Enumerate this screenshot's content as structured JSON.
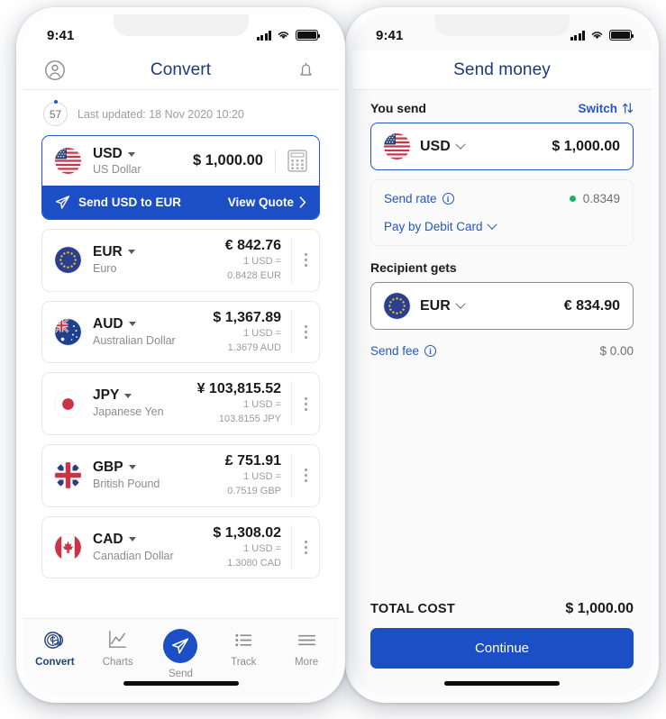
{
  "left_phone": {
    "status_bar": {
      "time": "9:41",
      "signal_icon": "cellular-bars-icon",
      "wifi_icon": "wifi-icon",
      "battery_icon": "battery-full-icon"
    },
    "header": {
      "title": "Convert",
      "profile_icon": "account-circle-icon",
      "bell_icon": "notification-bell-icon"
    },
    "updated": {
      "countdown": "57",
      "text": "Last updated: 18 Nov 2020 10:20"
    },
    "featured": {
      "code": "USD",
      "name": "US Dollar",
      "amount": "$ 1,000.00",
      "calculator_icon": "calculator-icon",
      "banner_text": "Send USD to EUR",
      "banner_icon": "paper-plane-icon",
      "banner_action": "View Quote",
      "banner_chevron": "chevron-right-icon"
    },
    "currencies": [
      {
        "code": "EUR",
        "name": "Euro",
        "amount": "€ 842.76",
        "rate_line1": "1 USD =",
        "rate_line2": "0.8428 EUR",
        "flag": "eu"
      },
      {
        "code": "AUD",
        "name": "Australian Dollar",
        "amount": "$ 1,367.89",
        "rate_line1": "1 USD =",
        "rate_line2": "1.3679 AUD",
        "flag": "au"
      },
      {
        "code": "JPY",
        "name": "Japanese Yen",
        "amount": "¥ 103,815.52",
        "rate_line1": "1 USD =",
        "rate_line2": "103.8155 JPY",
        "flag": "jp"
      },
      {
        "code": "GBP",
        "name": "British Pound",
        "amount": "£ 751.91",
        "rate_line1": "1 USD =",
        "rate_line2": "0.7519 GBP",
        "flag": "gb"
      },
      {
        "code": "CAD",
        "name": "Canadian Dollar",
        "amount": "$ 1,308.02",
        "rate_line1": "1 USD =",
        "rate_line2": "1.3080 CAD",
        "flag": "ca"
      }
    ],
    "tabs": [
      {
        "label": "Convert",
        "icon": "coins-dollar-icon",
        "active": true
      },
      {
        "label": "Charts",
        "icon": "line-chart-icon",
        "active": false
      },
      {
        "label": "Send",
        "icon": "paper-plane-icon",
        "active": false
      },
      {
        "label": "Track",
        "icon": "list-icon",
        "active": false
      },
      {
        "label": "More",
        "icon": "hamburger-menu-icon",
        "active": false
      }
    ]
  },
  "right_phone": {
    "status_bar": {
      "time": "9:41",
      "signal_icon": "cellular-bars-icon",
      "wifi_icon": "wifi-icon",
      "battery_icon": "battery-full-icon"
    },
    "header": {
      "title": "Send money"
    },
    "you_send": {
      "label": "You send",
      "switch_label": "Switch",
      "switch_icon": "swap-vertical-arrows-icon",
      "currency": "USD",
      "amount": "$ 1,000.00",
      "flag": "us"
    },
    "rate_panel": {
      "send_rate_label": "Send rate",
      "send_rate_info_icon": "info-circle-icon",
      "send_rate_value": "0.8349",
      "status_dot_color": "#18b46b",
      "pay_method_label": "Pay by Debit Card",
      "pay_method_chevron": "chevron-down-icon"
    },
    "recipient": {
      "label": "Recipient gets",
      "currency": "EUR",
      "amount": "€ 834.90",
      "flag": "eu"
    },
    "fee": {
      "label": "Send fee",
      "info_icon": "info-circle-icon",
      "value": "$ 0.00"
    },
    "total": {
      "label": "TOTAL COST",
      "value": "$ 1,000.00"
    },
    "cta": {
      "label": "Continue"
    }
  },
  "colors": {
    "brand_blue": "#1c4fc6",
    "link_blue": "#2455c9",
    "title_navy": "#1e3a78",
    "green": "#18b46b"
  }
}
